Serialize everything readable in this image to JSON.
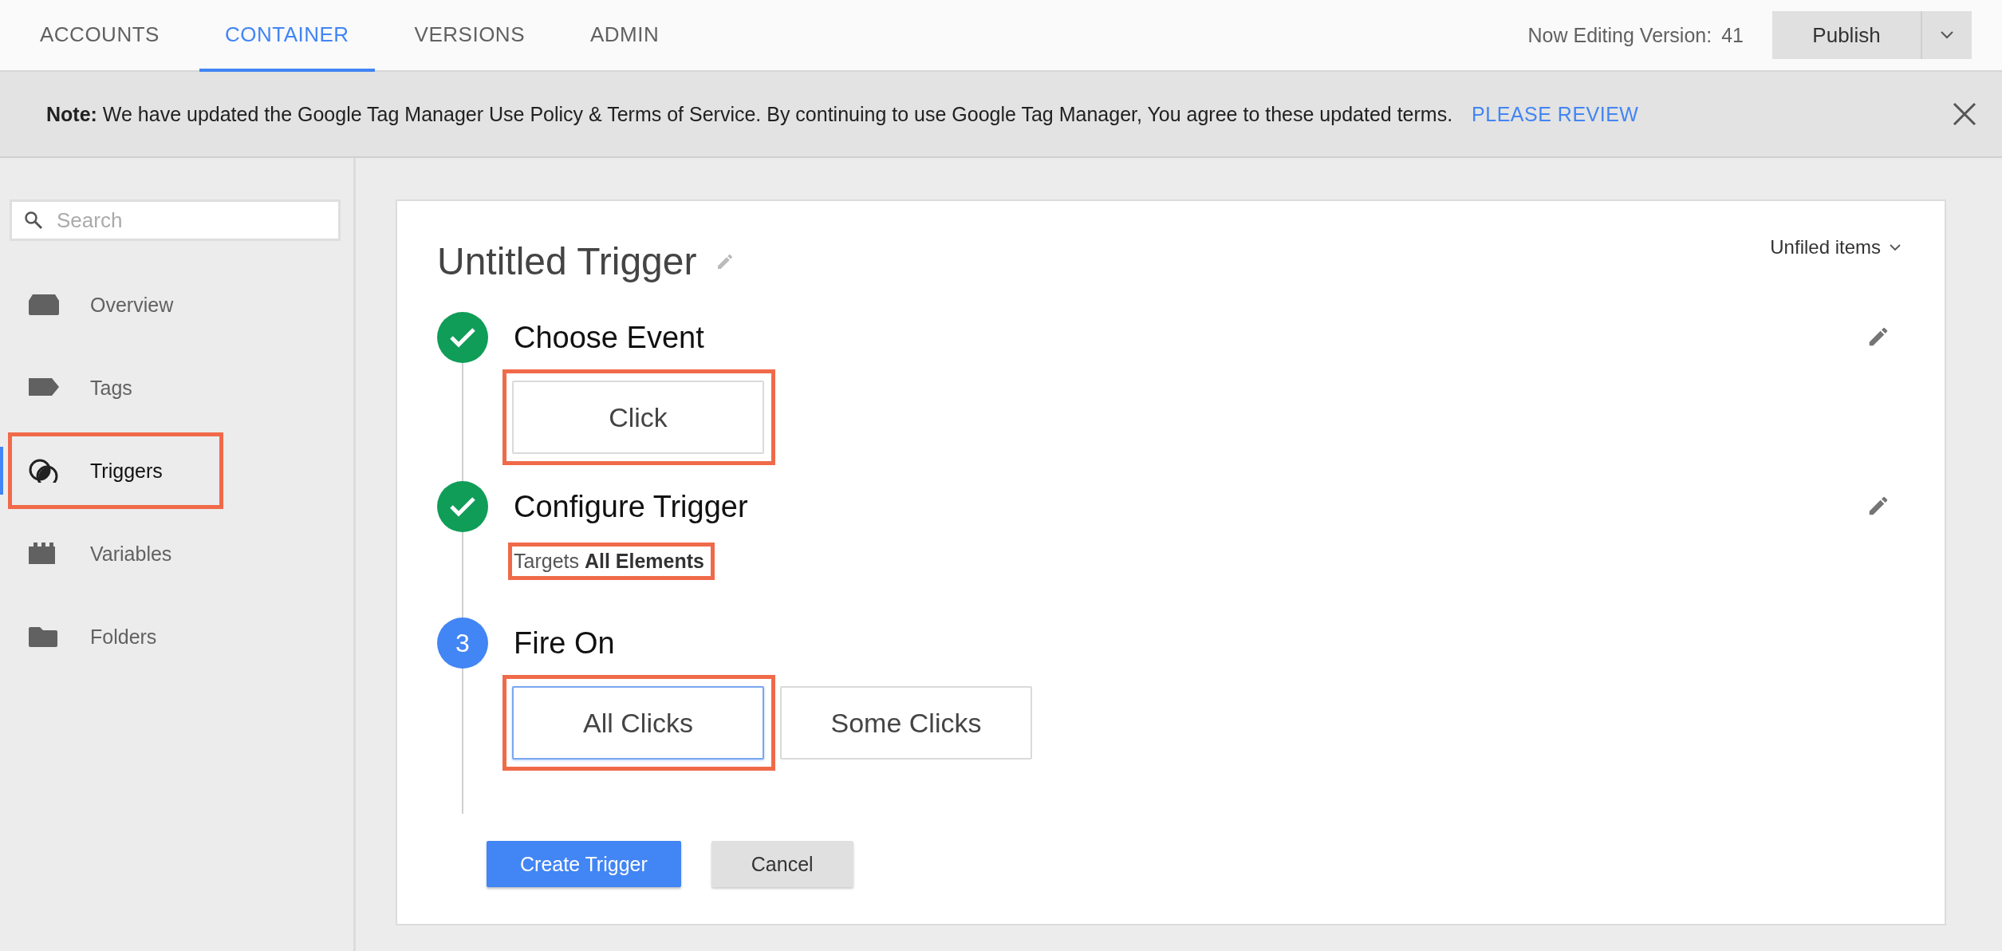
{
  "top_bar": {
    "tabs": [
      {
        "label": "ACCOUNTS",
        "selected": false
      },
      {
        "label": "CONTAINER",
        "selected": true
      },
      {
        "label": "VERSIONS",
        "selected": false
      },
      {
        "label": "ADMIN",
        "selected": false
      }
    ],
    "version_label": "Now Editing Version:",
    "version_number": "41",
    "publish_button": "Publish"
  },
  "notice": {
    "text": "**Note:** We have updated the Google Tag Manager Use Policy & Terms of Service. By continuing to use Google Tag Manager, You agree to these updated terms.",
    "link": "PLEASE REVIEW"
  },
  "sidebar": {
    "search": {
      "placeholder": "Search"
    },
    "items": [
      {
        "label": "Overview",
        "selected": false,
        "highlighted": false
      },
      {
        "label": "Tags",
        "selected": false,
        "highlighted": false
      },
      {
        "label": "Triggers",
        "selected": true,
        "highlighted": true
      },
      {
        "label": "Variables",
        "selected": false,
        "highlighted": false
      },
      {
        "label": "Folders",
        "selected": false,
        "highlighted": false
      }
    ]
  },
  "trigger": {
    "title": "Untitled Trigger",
    "folder": "Unfiled items",
    "steps": [
      {
        "title": "Choose Event",
        "completed": true,
        "editable": true,
        "kind": "choice",
        "options": [
          {
            "label": "Click",
            "selected": false,
            "highlighted": true
          }
        ]
      },
      {
        "title": "Configure Trigger",
        "completed": true,
        "editable": true,
        "kind": "summary",
        "summary": {
          "text": "Targets **All Elements**",
          "highlighted": true
        }
      },
      {
        "title": "Fire On",
        "completed": false,
        "number": "3",
        "editable": false,
        "kind": "choice",
        "options": [
          {
            "label": "All Clicks",
            "selected": true,
            "highlighted": true
          },
          {
            "label": "Some Clicks",
            "selected": false,
            "highlighted": false
          }
        ]
      }
    ],
    "buttons": [
      {
        "label": "Create Trigger",
        "kind": "primary"
      },
      {
        "label": "Cancel",
        "kind": "secondary"
      }
    ]
  }
}
